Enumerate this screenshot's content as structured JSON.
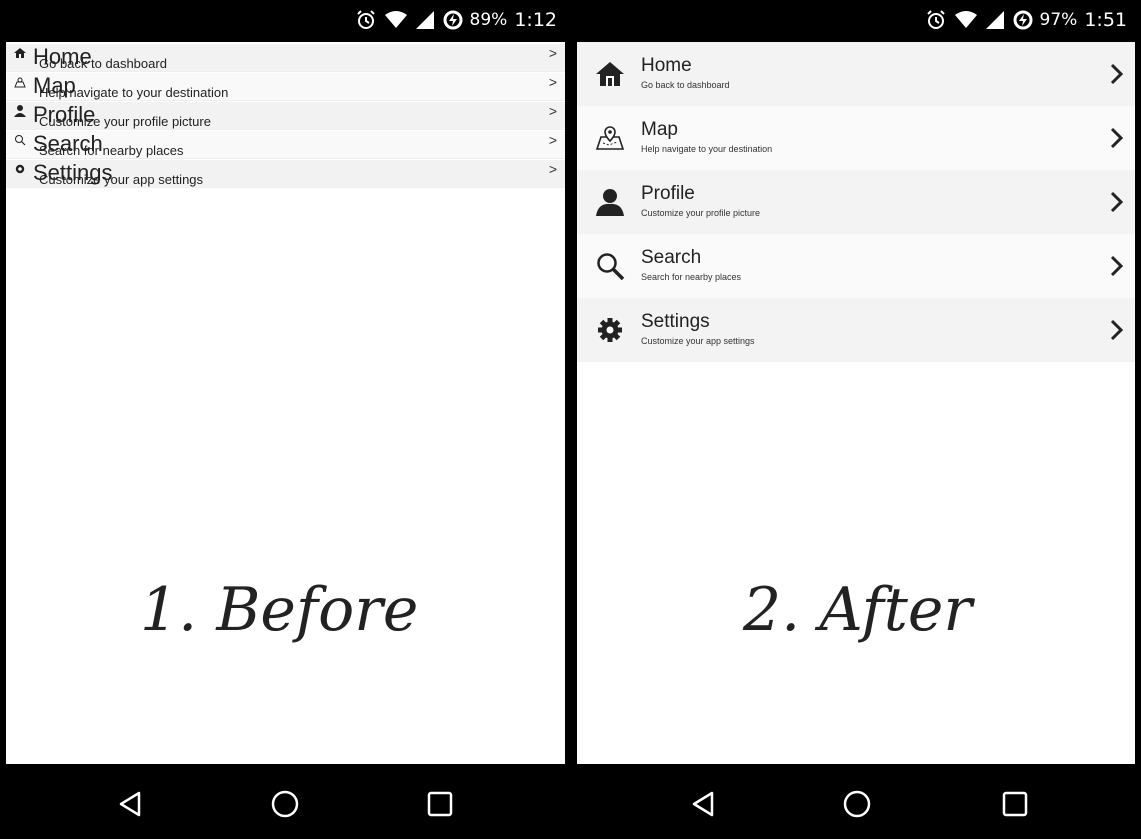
{
  "before": {
    "status": {
      "battery": "89%",
      "time": "1:12"
    },
    "caption": "1. Before"
  },
  "after": {
    "status": {
      "battery": "97%",
      "time": "1:51"
    },
    "caption": "2. After"
  },
  "menu": [
    {
      "icon": "home-icon",
      "title": "Home",
      "subtitle": "Go back to dashboard"
    },
    {
      "icon": "map-icon",
      "title": "Map",
      "subtitle": "Help navigate to your destination"
    },
    {
      "icon": "profile-icon",
      "title": "Profile",
      "subtitle": "Customize your profile picture"
    },
    {
      "icon": "search-icon",
      "title": "Search",
      "subtitle": "Search for nearby places"
    },
    {
      "icon": "gear-icon",
      "title": "Settings",
      "subtitle": "Customize your app settings"
    }
  ],
  "navigation": [
    "back-icon",
    "home-circle-icon",
    "recents-icon"
  ]
}
